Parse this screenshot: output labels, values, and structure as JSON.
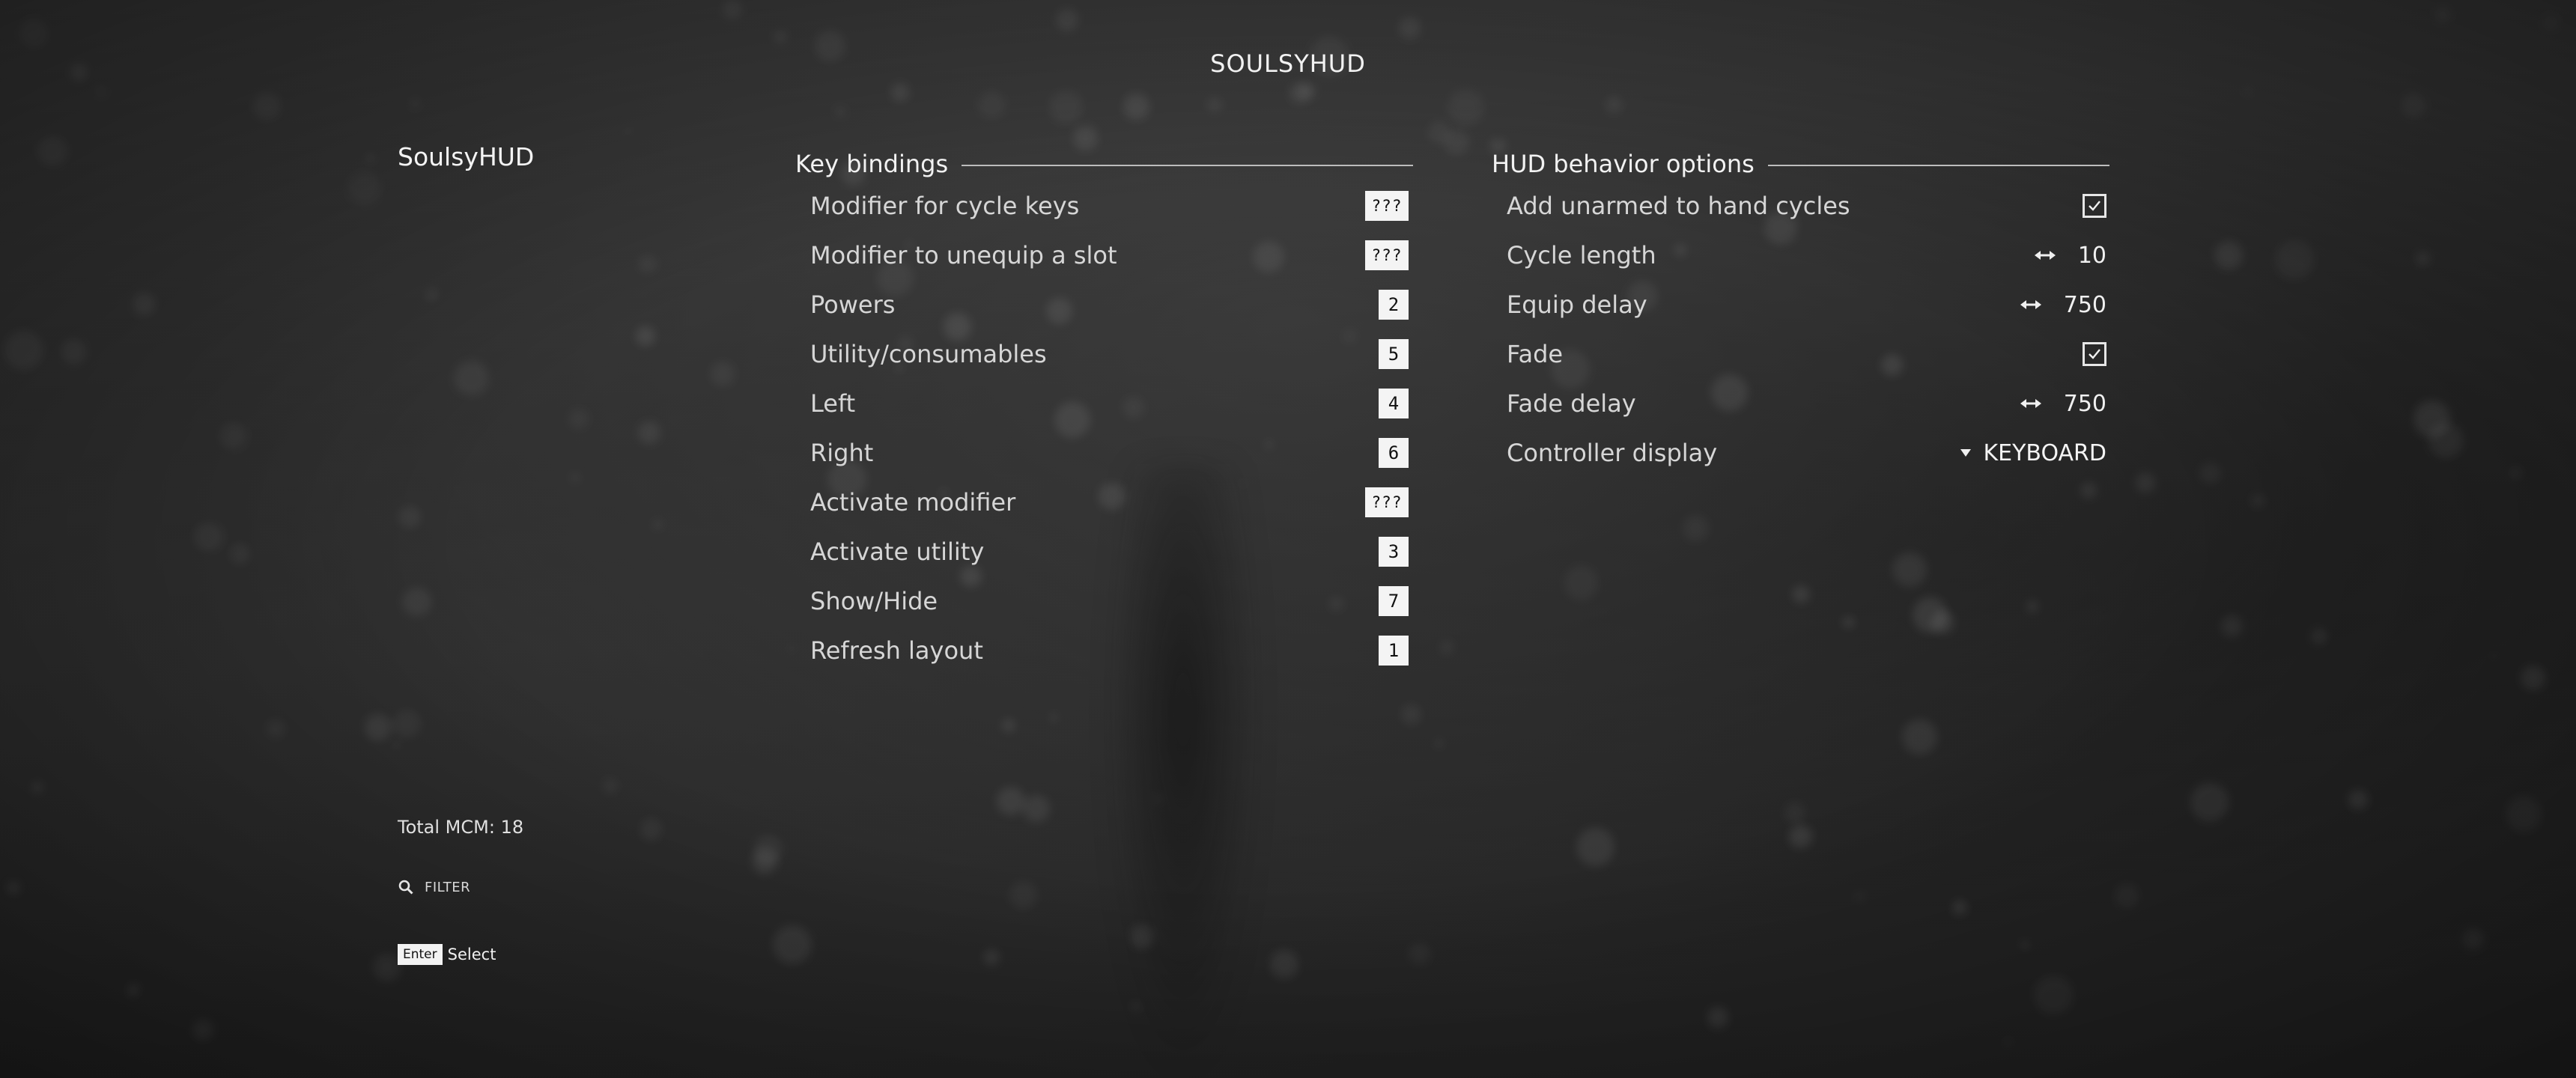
{
  "page_title": "SOULSYHUD",
  "mod_list": {
    "selected_mod": "SoulsyHUD",
    "total_label": "Total MCM: 18",
    "filter_label": "FILTER"
  },
  "hint": {
    "key": "Enter",
    "action": "Select"
  },
  "key_bindings": {
    "title": "Key bindings",
    "rows": [
      {
        "label": "Modifier for cycle keys",
        "key": "???"
      },
      {
        "label": "Modifier to unequip a slot",
        "key": "???"
      },
      {
        "label": "Powers",
        "key": "2"
      },
      {
        "label": "Utility/consumables",
        "key": "5"
      },
      {
        "label": "Left",
        "key": "4"
      },
      {
        "label": "Right",
        "key": "6"
      },
      {
        "label": "Activate modifier",
        "key": "???"
      },
      {
        "label": "Activate utility",
        "key": "3"
      },
      {
        "label": "Show/Hide",
        "key": "7"
      },
      {
        "label": "Refresh layout",
        "key": "1"
      }
    ]
  },
  "hud_options": {
    "title": "HUD behavior options",
    "rows": [
      {
        "label": "Add unarmed to hand cycles",
        "type": "checkbox",
        "checked": true
      },
      {
        "label": "Cycle length",
        "type": "slider",
        "value": "10"
      },
      {
        "label": "Equip delay",
        "type": "slider",
        "value": "750"
      },
      {
        "label": "Fade",
        "type": "checkbox",
        "checked": true
      },
      {
        "label": "Fade delay",
        "type": "slider",
        "value": "750"
      },
      {
        "label": "Controller display",
        "type": "menu",
        "value": "KEYBOARD"
      }
    ]
  },
  "colors": {
    "text": "#e8e8e8",
    "key_box_bg": "#f4f4f4",
    "rule": "#bdbdbd"
  }
}
